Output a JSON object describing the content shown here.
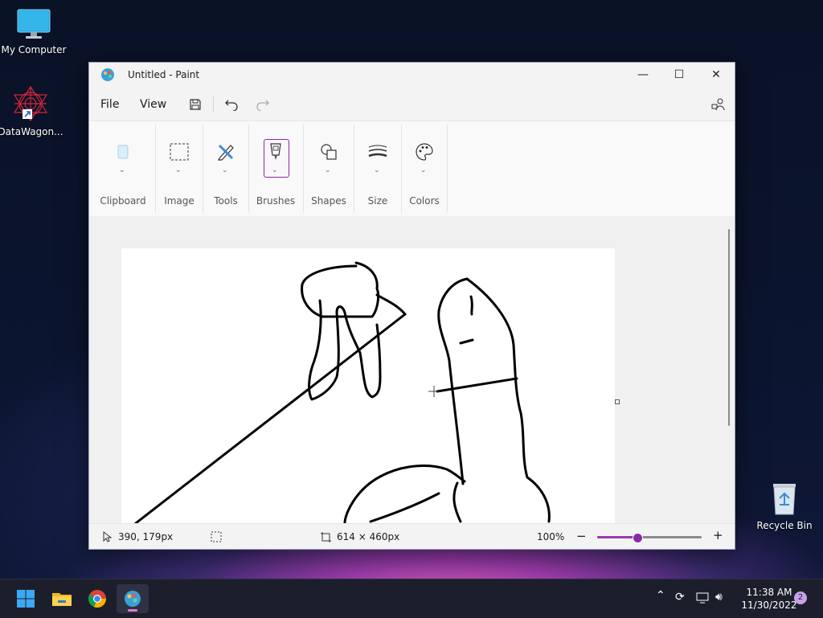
{
  "desktop": {
    "icons": [
      {
        "label": "My Computer"
      },
      {
        "label": "DataWagon..."
      },
      {
        "label": "Recycle Bin"
      }
    ]
  },
  "window": {
    "title": "Untitled - Paint",
    "controls": {
      "minimize": "—",
      "maximize": "☐",
      "close": "✕"
    }
  },
  "menubar": {
    "file": "File",
    "view": "View"
  },
  "ribbon": {
    "groups": [
      {
        "label": "Clipboard"
      },
      {
        "label": "Image"
      },
      {
        "label": "Tools"
      },
      {
        "label": "Brushes"
      },
      {
        "label": "Shapes"
      },
      {
        "label": "Size"
      },
      {
        "label": "Colors"
      }
    ]
  },
  "statusbar": {
    "cursor_position": "390, 179px",
    "canvas_size": "614 × 460px",
    "zoom": "100%",
    "zoom_slider_fraction": 0.38
  },
  "taskbar": {
    "time": "11:38 AM",
    "date": "11/30/2022",
    "notification_count": "2"
  },
  "colors": {
    "accent": "#8a2aa6",
    "taskbar": "#1c1f2b"
  }
}
